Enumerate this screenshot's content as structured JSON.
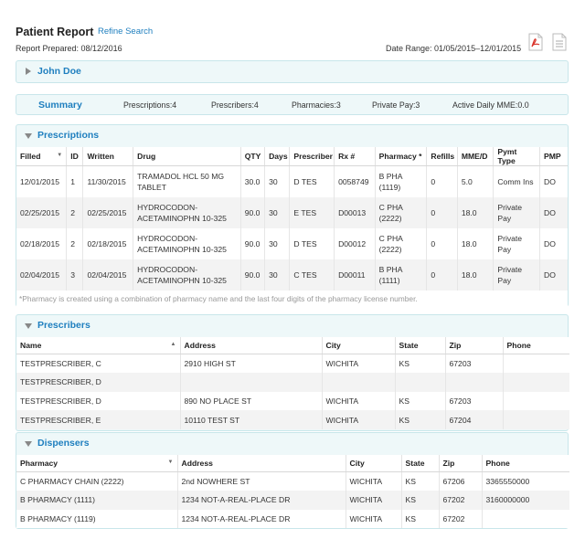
{
  "header": {
    "title": "Patient Report",
    "refine_label": "Refine Search",
    "report_prepared": "Report Prepared: 08/12/2016",
    "date_range": "Date Range: 01/05/2015–12/01/2015",
    "pdf_icon": "pdf-icon",
    "doc_icon": "document-icon"
  },
  "patient": {
    "name": "John Doe"
  },
  "summary": {
    "label": "Summary",
    "prescriptions": "Prescriptions:4",
    "prescribers": "Prescribers:4",
    "pharmacies": "Pharmacies:3",
    "private_pay": "Private Pay:3",
    "active_mme": "Active Daily MME:0.0"
  },
  "prescriptions": {
    "title": "Prescriptions",
    "columns": [
      "Filled",
      "ID",
      "Written",
      "Drug",
      "QTY",
      "Days",
      "Prescriber",
      "Rx #",
      "Pharmacy *",
      "Refills",
      "MME/D",
      "Pymt Type",
      "PMP"
    ],
    "rows": [
      [
        "12/01/2015",
        "1",
        "11/30/2015",
        "TRAMADOL HCL 50 MG TABLET",
        "30.0",
        "30",
        "D TES",
        "0058749",
        "B PHA (1119)",
        "0",
        "5.0",
        "Comm Ins",
        "DO"
      ],
      [
        "02/25/2015",
        "2",
        "02/25/2015",
        "HYDROCODON-ACETAMINOPHN 10-325",
        "90.0",
        "30",
        "E TES",
        "D00013",
        "C PHA (2222)",
        "0",
        "18.0",
        "Private Pay",
        "DO"
      ],
      [
        "02/18/2015",
        "2",
        "02/18/2015",
        "HYDROCODON-ACETAMINOPHN 10-325",
        "90.0",
        "30",
        "D TES",
        "D00012",
        "C PHA (2222)",
        "0",
        "18.0",
        "Private Pay",
        "DO"
      ],
      [
        "02/04/2015",
        "3",
        "02/04/2015",
        "HYDROCODON-ACETAMINOPHN 10-325",
        "90.0",
        "30",
        "C TES",
        "D00011",
        "B PHA (1111)",
        "0",
        "18.0",
        "Private Pay",
        "DO"
      ]
    ],
    "footnote": "*Pharmacy is created using a combination of pharmacy name and the last four digits of the pharmacy license number."
  },
  "prescribers": {
    "title": "Prescribers",
    "columns": [
      "Name",
      "Address",
      "City",
      "State",
      "Zip",
      "Phone"
    ],
    "rows": [
      [
        "TESTPRESCRIBER, C",
        "2910 HIGH ST",
        "WICHITA",
        "KS",
        "67203",
        ""
      ],
      [
        "TESTPRESCRIBER, D",
        "",
        "",
        "",
        "",
        ""
      ],
      [
        "TESTPRESCRIBER, D",
        "890 NO PLACE ST",
        "WICHITA",
        "KS",
        "67203",
        ""
      ],
      [
        "TESTPRESCRIBER, E",
        "10110 TEST ST",
        "WICHITA",
        "KS",
        "67204",
        ""
      ]
    ]
  },
  "dispensers": {
    "title": "Dispensers",
    "columns": [
      "Pharmacy",
      "Address",
      "City",
      "State",
      "Zip",
      "Phone"
    ],
    "rows": [
      [
        "C PHARMACY CHAIN (2222)",
        "2nd NOWHERE ST",
        "WICHITA",
        "KS",
        "67206",
        "3365550000"
      ],
      [
        "B PHARMACY (1111)",
        "1234 NOT-A-REAL-PLACE DR",
        "WICHITA",
        "KS",
        "67202",
        "3160000000"
      ],
      [
        "B PHARMACY (1119)",
        "1234 NOT-A-REAL-PLACE DR",
        "WICHITA",
        "KS",
        "67202",
        ""
      ]
    ]
  },
  "colors": {
    "accent": "#1f7fbf",
    "panel_bg": "#eef8f9",
    "panel_border": "#c8e6ea",
    "pdf_red": "#d9342b"
  }
}
